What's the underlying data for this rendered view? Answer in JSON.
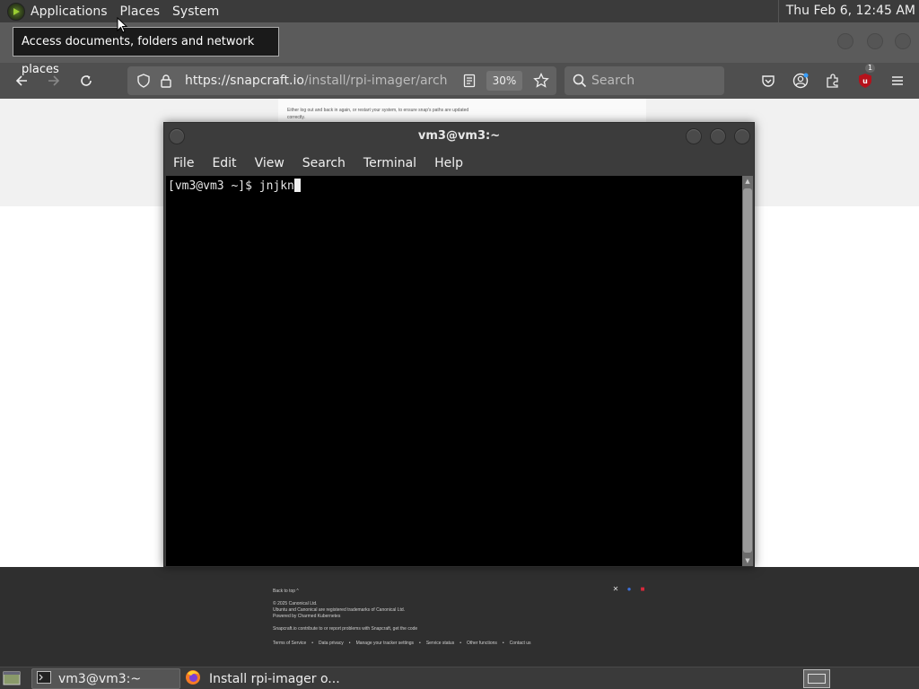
{
  "top_panel": {
    "menus": [
      "Applications",
      "Places",
      "System"
    ],
    "clock": "Thu Feb  6, 12:45 AM"
  },
  "tooltip": {
    "text": "Access documents, folders and network places"
  },
  "browser": {
    "url_host": "https://snapcraft.io",
    "url_path": "/install/rpi-imager/arch",
    "zoom": "30%",
    "search_placeholder": "Search",
    "extension_badge": "1"
  },
  "webpage": {
    "intro_text": "Either log out and back in again, or restart your system, to ensure snap's paths are updated correctly.",
    "footer": {
      "back_to_top": "Back to top ^",
      "copyright": "© 2025 Canonical Ltd.",
      "trademark": "Ubuntu and Canonical are registered trademarks of Canonical Ltd.",
      "powered_by": "Powered by Charmed Kubernetes",
      "contribute": "Snapcraft.io contribute to or report problems with Snapcraft, get the code",
      "links": [
        "Terms of Service",
        "Data privacy",
        "Manage your tracker settings",
        "Service status",
        "Other functions",
        "Contact us"
      ]
    }
  },
  "terminal": {
    "title": "vm3@vm3:~",
    "menus": [
      "File",
      "Edit",
      "View",
      "Search",
      "Terminal",
      "Help"
    ],
    "prompt": "[vm3@vm3 ~]$ ",
    "input": "jnjkn"
  },
  "bottom_panel": {
    "tasks": [
      "vm3@vm3:~",
      "Install rpi-imager o..."
    ]
  },
  "colors": {
    "panel_bg": "#3b3b3b",
    "terminal_bg": "#000000",
    "footer_bg": "#2f2f2f",
    "ublock_red": "#b5121b"
  }
}
